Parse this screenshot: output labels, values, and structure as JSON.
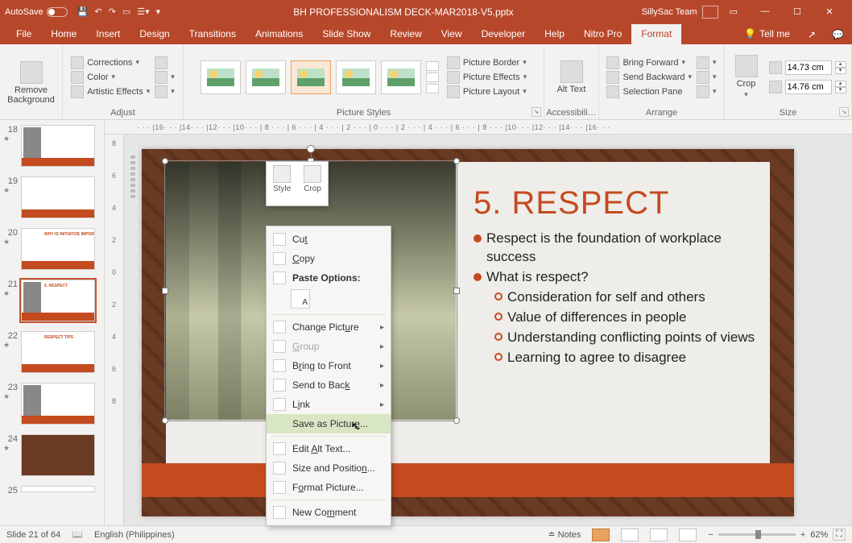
{
  "titlebar": {
    "autosave": "AutoSave",
    "filename": "BH PROFESSIONALISM DECK-MAR2018-V5.pptx",
    "account": "SillySac Team"
  },
  "tabs": {
    "file": "File",
    "home": "Home",
    "insert": "Insert",
    "design": "Design",
    "transitions": "Transitions",
    "animations": "Animations",
    "slideshow": "Slide Show",
    "review": "Review",
    "view": "View",
    "developer": "Developer",
    "help": "Help",
    "nitro": "Nitro Pro",
    "format": "Format",
    "tellme": "Tell me"
  },
  "ribbon": {
    "removebg": "Remove Background",
    "corrections": "Corrections",
    "color": "Color",
    "artistic": "Artistic Effects",
    "adjust": "Adjust",
    "picstyles": "Picture Styles",
    "border": "Picture Border",
    "effects": "Picture Effects",
    "layout": "Picture Layout",
    "alttext": "Alt Text",
    "access": "Accessibili…",
    "bringfwd": "Bring Forward",
    "sendback": "Send Backward",
    "selpane": "Selection Pane",
    "arrange": "Arrange",
    "crop": "Crop",
    "height": "14.73 cm",
    "width": "14.76 cm",
    "size": "Size"
  },
  "ruler_h": "· · · |16· · · |14· · · |12· · · |10· · · | 8 · · · | 6 · · · | 4 · · · | 2 · · · | 0 · · · | 2 · · · | 4 · · · | 6 · · · | 8 · · · |10· · · |12· · · |14· · · |16· · ·",
  "minitb": {
    "style": "Style",
    "crop": "Crop"
  },
  "ctx": {
    "cut": "Cut",
    "copy": "Copy",
    "pasteopt": "Paste Options:",
    "change": "Change Picture",
    "group": "Group",
    "bring": "Bring to Front",
    "send": "Send to Back",
    "link": "Link",
    "save": "Save as Picture...",
    "alt": "Edit Alt Text...",
    "size": "Size and Position...",
    "format": "Format Picture...",
    "comment": "New Comment"
  },
  "slide": {
    "title": "5. RESPECT",
    "b1": "Respect is the foundation of workplace success",
    "b2": "What is respect?",
    "s1": "Consideration for self and others",
    "s2": "Value of differences in people",
    "s3": "Understanding conflicting points of views",
    "s4": "Learning to agree to disagree"
  },
  "thumbs": {
    "t18": "18",
    "t19": "19",
    "t20": "20",
    "t21": "21",
    "t22": "22",
    "t23": "23",
    "t24": "24",
    "t25": "25",
    "l18": "",
    "l19": "",
    "l20": "WHY IS INITIATIVE IMPORTANT?",
    "l21": "5. RESPECT",
    "l22": "RESPECT TIPS",
    "l23": "",
    "l24": "",
    "l25": ""
  },
  "status": {
    "slide": "Slide 21 of 64",
    "lang": "English (Philippines)",
    "notes": "Notes",
    "zoom": "62%"
  }
}
